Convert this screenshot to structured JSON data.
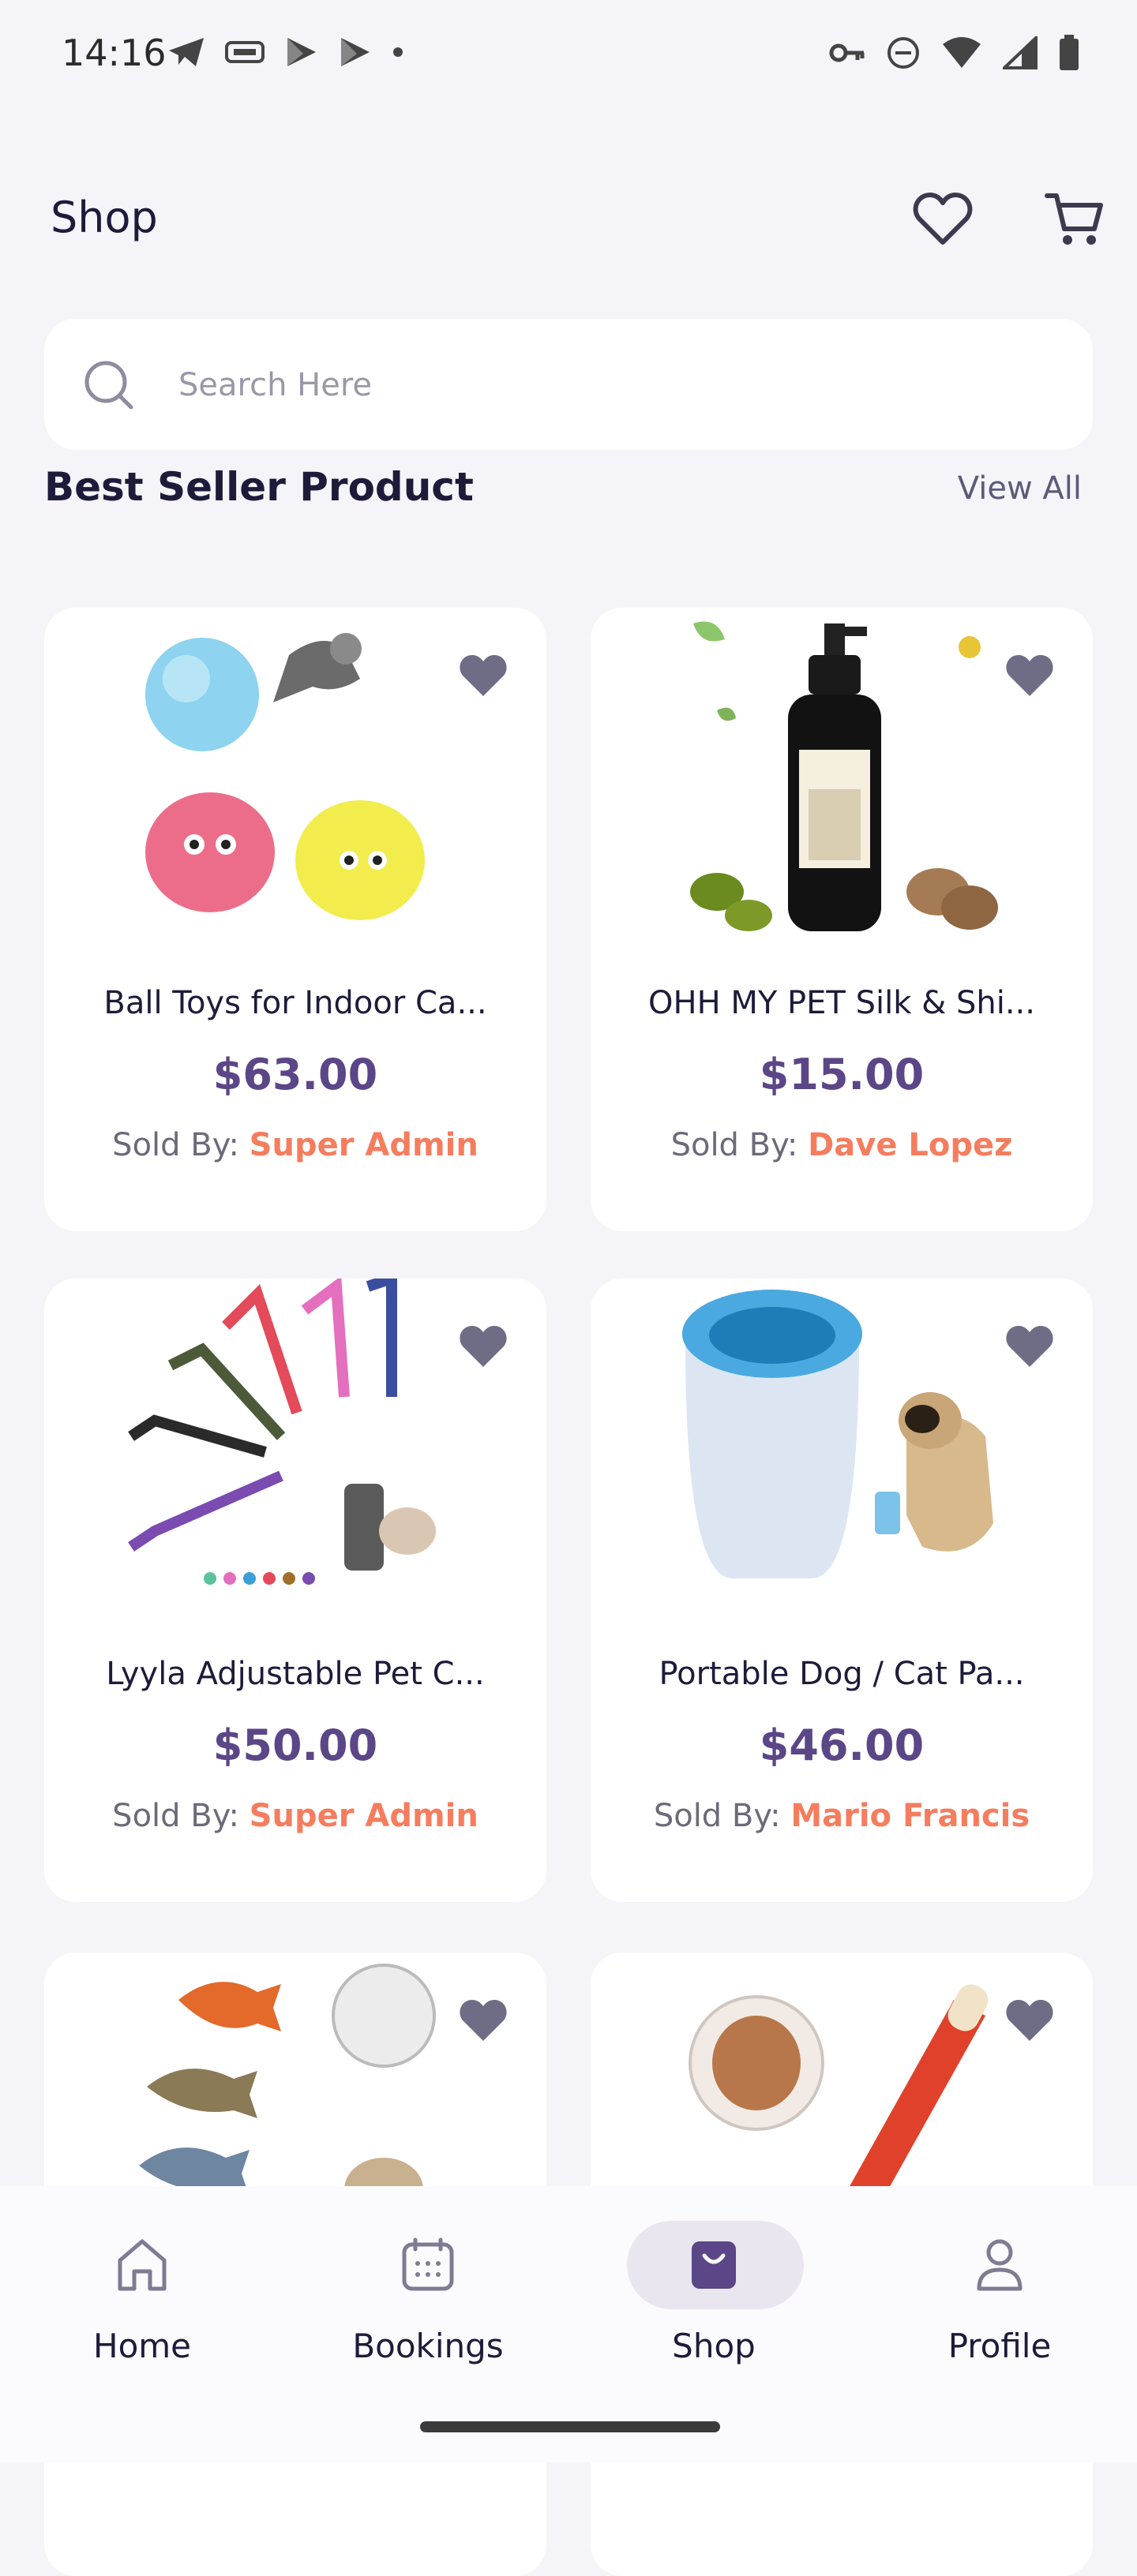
{
  "status_bar": {
    "time": "14:16"
  },
  "header": {
    "title": "Shop"
  },
  "search": {
    "placeholder": "Search Here"
  },
  "section": {
    "title": "Best Seller Product",
    "view_all": "View All"
  },
  "colors": {
    "accent": "#5b4687",
    "seller": "#f57d5e",
    "background": "#f5f4f9",
    "card": "#ffffff"
  },
  "seller_prefix": "Sold By: ",
  "products": [
    {
      "name": "Ball Toys for Indoor Ca...",
      "price": "$63.00",
      "seller": "Super Admin"
    },
    {
      "name": "OHH MY PET Silk & Shi...",
      "price": "$15.00",
      "seller": "Dave Lopez"
    },
    {
      "name": "Lyyla Adjustable Pet C...",
      "price": "$50.00",
      "seller": "Super Admin"
    },
    {
      "name": "Portable Dog / Cat Pa...",
      "price": "$46.00",
      "seller": "Mario Francis"
    },
    {
      "name": "",
      "price": "",
      "seller": ""
    },
    {
      "name": "",
      "price": "",
      "seller": ""
    }
  ],
  "nav": [
    {
      "label": "Home",
      "icon": "home-icon",
      "active": false
    },
    {
      "label": "Bookings",
      "icon": "calendar-icon",
      "active": false
    },
    {
      "label": "Shop",
      "icon": "shopping-bag-icon",
      "active": true
    },
    {
      "label": "Profile",
      "icon": "person-icon",
      "active": false
    }
  ]
}
